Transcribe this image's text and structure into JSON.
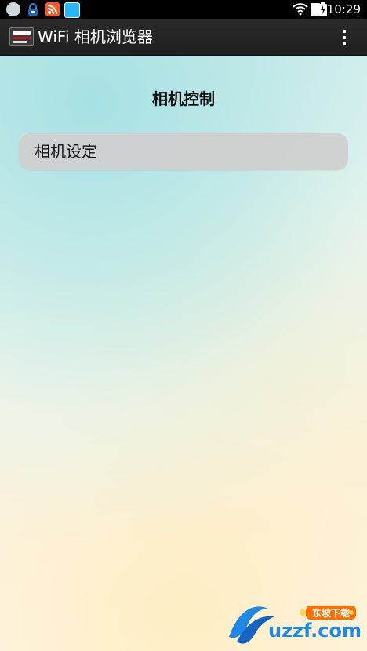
{
  "status_bar": {
    "time": "10:29",
    "icons": [
      "notification-icon",
      "lock-icon",
      "rss-icon",
      "app-icon",
      "wifi-icon",
      "sim-icon",
      "battery-icon"
    ]
  },
  "app_bar": {
    "title": "WiFi 相机浏览器",
    "logo_icon": "app-logo-icon",
    "overflow_icon": "overflow-menu-icon"
  },
  "main": {
    "section_title": "相机控制",
    "items": [
      {
        "label": "相机设定"
      }
    ]
  },
  "watermark": {
    "brand_text": "东坡下载",
    "logo_text": "uzzf.com",
    "icon": "uzzf-logo-icon"
  },
  "colors": {
    "app_bar_bg": "#242424",
    "button_bg": "#d0d0d0",
    "title_text": "#111111"
  }
}
